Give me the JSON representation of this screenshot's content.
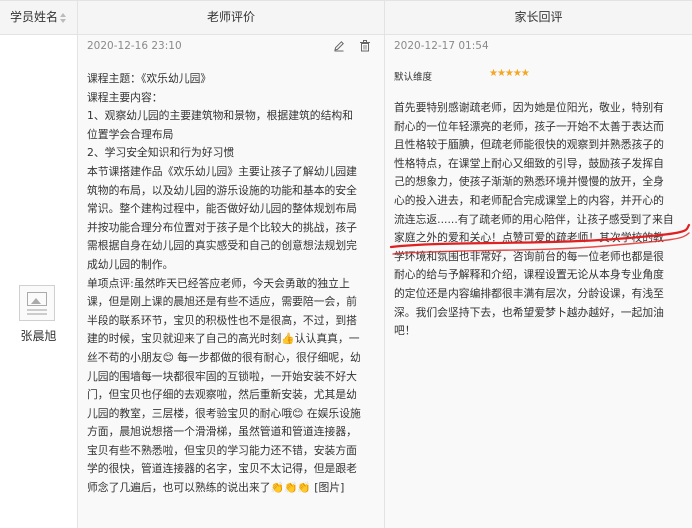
{
  "table": {
    "columns": {
      "student": "学员姓名",
      "teacher": "老师评价",
      "parent": "家长回评"
    }
  },
  "student": {
    "name": "张晨旭",
    "avatar_icon": "image-placeholder-icon"
  },
  "teacher_review": {
    "timestamp": "2020-12-16 23:10",
    "edit_icon": "pencil-icon",
    "delete_icon": "trash-icon",
    "lines": [
      "课程主题：《欢乐幼儿园》",
      "课程主要内容：",
      "1、观察幼儿园的主要建筑物和景物，根据建筑的结构和",
      "位置学会合理布局",
      "2、学习安全知识和行为好习惯",
      "本节课搭建作品《欢乐幼儿园》主要让孩子了解幼儿园建",
      "筑物的布局，以及幼儿园的游乐设施的功能和基本的安全",
      "常识。整个建构过程中，能否做好幼儿园的整体规划布局",
      "并按功能合理分布位置对于孩子是个比较大的挑战，孩子",
      "需根据自身在幼儿园的真实感受和自己的创意想法规划完",
      "成幼儿园的制作。",
      "单项点评:虽然昨天已经答应老师，今天会勇敢的独立上",
      "课，但是刚上课的晨旭还是有些不适应，需要陪一会，前",
      "半段的联系环节，宝贝的积极性也不是很高，不过，到搭",
      "建的时候，宝贝就迎来了自己的高光时刻👍认认真真，一",
      "丝不苟的小朋友😊 每一步都做的很有耐心，很仔细呢，幼",
      "儿园的围墙每一块都很牢固的互锁啦，一开始安装不好大",
      "门，但宝贝也仔细的去观察啦，然后重新安装，尤其是幼",
      "儿园的教室，三层楼，很考验宝贝的耐心哦😊 在娱乐设施",
      "方面，晨旭说想搭一个滑滑梯，虽然管道和管道连接器，",
      "宝贝有些不熟悉啦，但宝贝的学习能力还不错，安装方面",
      "学的很快，管道连接器的名字，宝贝不太记得，但是跟老",
      "师念了几遍后，也可以熟练的说出来了👏👏👏 [图片]"
    ]
  },
  "parent_review": {
    "timestamp": "2020-12-17 01:54",
    "rating_label": "默认维度",
    "stars": "★★★★★",
    "star_color": "#f5a623",
    "annotation_color": "#e02020",
    "lines": [
      "首先要特别感谢疏老师，因为她是位阳光，敬业，特别有",
      "耐心的一位年轻漂亮的老师，孩子一开始不太善于表达而",
      "且性格较于腼腆，但疏老师能很快的观察到并熟悉孩子的",
      "性格特点，在课堂上耐心又细致的引导，鼓励孩子发挥自",
      "己的想象力，使孩子渐渐的熟悉环境并慢慢的放开，全身",
      "心的投入进去，和老师配合完成课堂上的内容，并开心的",
      "流连忘返......有了疏老师的用心陪伴，让孩子感受到了来自",
      "家庭之外的爱和关心！点赞可爱的疏老师！其次学校的教",
      "学环境和氛围也非常好，咨询前台的每一位老师也都是很",
      "耐心的给与予解释和介绍，课程设置无论从本身专业角度",
      "的定位还是内容编排都很丰满有层次，分龄设课，有浅至",
      "深。我们会坚持下去，也希望爱梦卜越办越好，一起加油",
      "吧！"
    ]
  }
}
